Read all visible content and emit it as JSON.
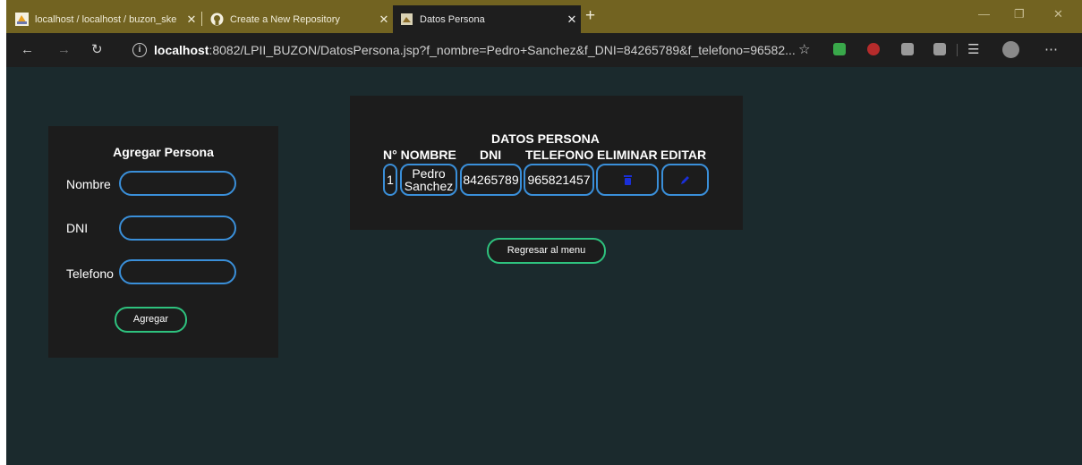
{
  "browser": {
    "tabs": [
      {
        "title": "localhost / localhost / buzon_ske",
        "icon": "phpmyadmin-icon"
      },
      {
        "title": "Create a New Repository",
        "icon": "github-icon"
      },
      {
        "title": "Datos Persona",
        "icon": "page-icon",
        "active": true
      }
    ],
    "new_tab": "+",
    "url_host": "localhost",
    "url_rest": ":8082/LPII_BUZON/DatosPersona.jsp?f_nombre=Pedro+Sanchez&f_DNI=84265789&f_telefono=96582..."
  },
  "form": {
    "title": "Agregar Persona",
    "labels": {
      "nombre": "Nombre",
      "dni": "DNI",
      "telefono": "Telefono"
    },
    "values": {
      "nombre": "",
      "dni": "",
      "telefono": ""
    },
    "submit": "Agregar"
  },
  "table": {
    "title": "DATOS PERSONA",
    "headers": [
      "N° NOMBRE",
      "DNI",
      "TELEFONO",
      "ELIMINAR",
      "EDITAR"
    ],
    "rows": [
      {
        "n": "1",
        "nombre_1": "Pedro",
        "nombre_2": "Sanchez",
        "dni": "84265789",
        "telefono": "965821457",
        "delete_icon": "trash-icon",
        "edit_icon": "pencil-icon"
      }
    ]
  },
  "back_button": "Regresar al menu",
  "colors": {
    "page_bg": "#1b2a2d",
    "card_bg": "#1c1c1c",
    "input_border": "#3a8fd9",
    "button_border": "#2ec27e",
    "icon_blue": "#1a2fd8",
    "titlebar": "#726321"
  }
}
